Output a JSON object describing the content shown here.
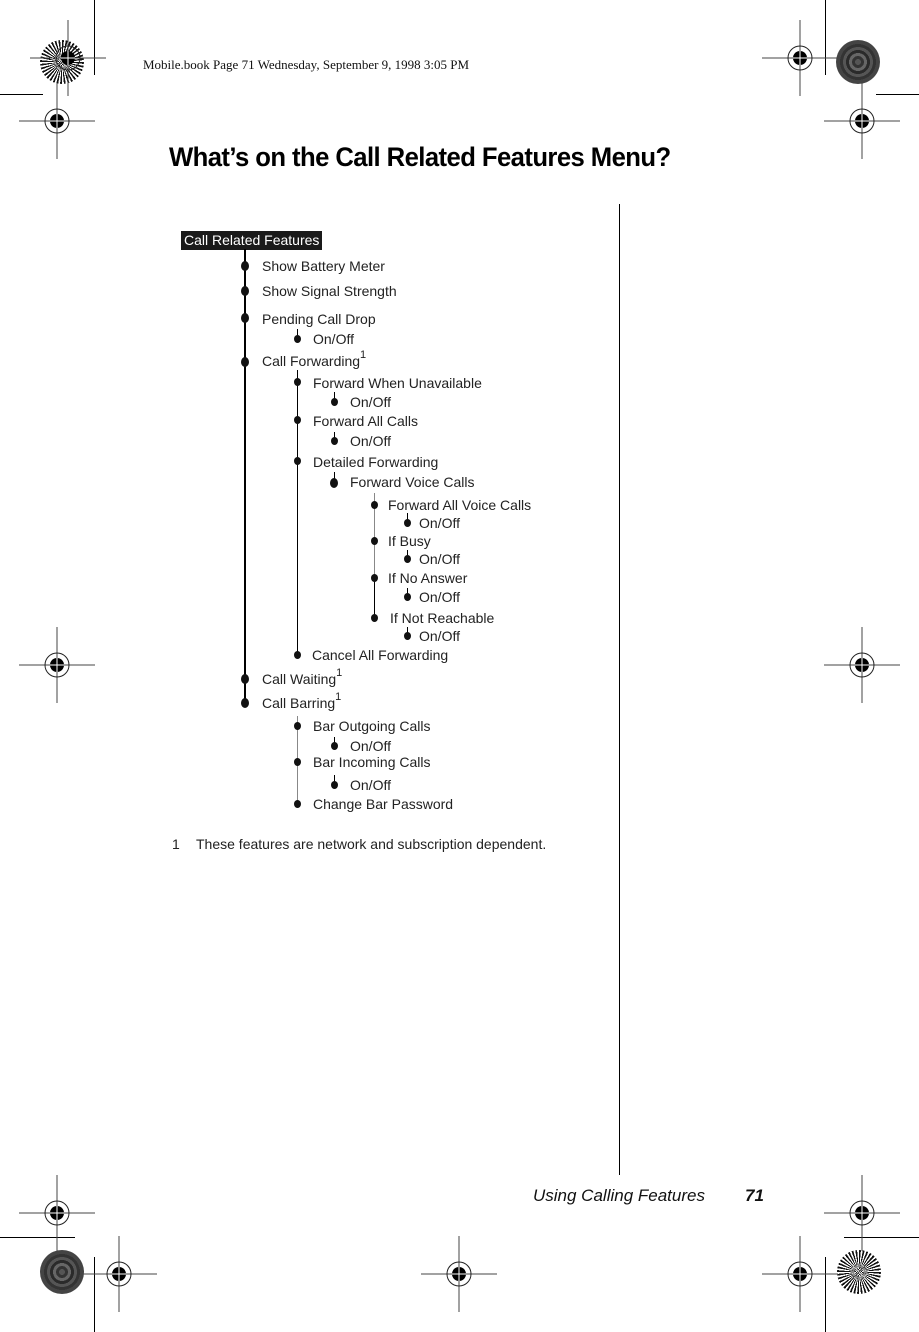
{
  "print_header": "Mobile.book  Page 71  Wednesday, September 9, 1998  3:05 PM",
  "title": "What’s on the Call Related Features Menu?",
  "menu": {
    "root": "Call Related Features",
    "items": [
      {
        "label": "Show Battery Meter"
      },
      {
        "label": "Show Signal Strength"
      },
      {
        "label": "Pending Call Drop",
        "children": [
          {
            "label": "On/Off"
          }
        ]
      },
      {
        "label": "Call Forwarding",
        "footnote": "1",
        "children": [
          {
            "label": "Forward When Unavailable",
            "children": [
              {
                "label": "On/Off"
              }
            ]
          },
          {
            "label": "Forward All Calls",
            "children": [
              {
                "label": "On/Off"
              }
            ]
          },
          {
            "label": "Detailed Forwarding",
            "children": [
              {
                "label": "Forward Voice Calls",
                "children": [
                  {
                    "label": "Forward All Voice Calls",
                    "children": [
                      {
                        "label": "On/Off"
                      }
                    ]
                  },
                  {
                    "label": "If Busy",
                    "children": [
                      {
                        "label": "On/Off"
                      }
                    ]
                  },
                  {
                    "label": "If No Answer",
                    "children": [
                      {
                        "label": "On/Off"
                      }
                    ]
                  },
                  {
                    "label": "If Not Reachable",
                    "children": [
                      {
                        "label": "On/Off"
                      }
                    ]
                  }
                ]
              }
            ]
          },
          {
            "label": "Cancel All Forwarding"
          }
        ]
      },
      {
        "label": "Call Waiting",
        "footnote": "1"
      },
      {
        "label": "Call Barring",
        "footnote": "1",
        "children": [
          {
            "label": "Bar Outgoing Calls",
            "children": [
              {
                "label": "On/Off"
              }
            ]
          },
          {
            "label": "Bar Incoming Calls",
            "children": [
              {
                "label": "On/Off"
              }
            ]
          },
          {
            "label": "Change Bar Password"
          }
        ]
      }
    ]
  },
  "footnote": {
    "number": "1",
    "text": "These features are network and subscription dependent."
  },
  "footer": {
    "section": "Using Calling Features",
    "page": "71"
  }
}
